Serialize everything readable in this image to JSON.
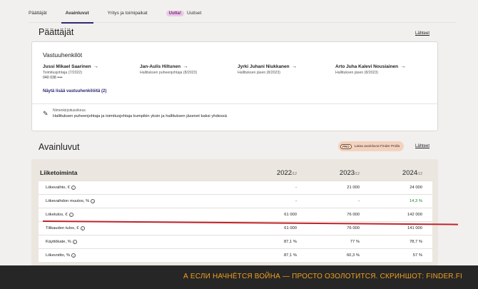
{
  "nav": {
    "tabs": [
      "Päättäjät",
      "Avainluvut",
      "Yritys ja toimipaikat"
    ],
    "new_badge": "Uutta!",
    "news": "Uutiset"
  },
  "officials": {
    "section_title": "Päättäjät",
    "sources_link": "Lähteet",
    "card_title": "Vastuuhenkilöt",
    "people": [
      {
        "name": "Jussi Mikael Saarinen",
        "role": "Toimitusjohtaja (7/2022)",
        "phone": "040 038 ••••"
      },
      {
        "name": "Jan-Aulis Hiltunen",
        "role": "Hallituksen puheenjohtaja (8/2023)"
      },
      {
        "name": "Jyrki Juhani Niukkanen",
        "role": "Hallituksen jäsen (8/2023)"
      },
      {
        "name": "Arto Juha Kalevi Nousiainen",
        "role": "Hallituksen jäsen (8/2023)"
      }
    ],
    "show_more": "Näytä lisää vastuuhenkilöitä (2)",
    "signature_label": "Nimenkirjoitusoikeus",
    "signature_text": "Hallituksen puheenjohtaja ja toimitusjohtaja kumpikin yksin ja hallituksen jäsenet kaksi yhdessä"
  },
  "key_figures": {
    "section_title": "Avainluvut",
    "pro_badge": "PRO",
    "pro_text": "Lataa avainluvut Finder Prolla",
    "sources_link": "Lähteet",
    "table_label": "Liiketoiminta",
    "years": [
      {
        "year": "2022",
        "sub": "/12"
      },
      {
        "year": "2023",
        "sub": "/12"
      },
      {
        "year": "2024",
        "sub": "/12"
      }
    ],
    "rows": [
      {
        "label": "Liikevaihto, €",
        "values": [
          "-",
          "21 000",
          "24 000"
        ]
      },
      {
        "label": "Liikevaihdon muutos, %",
        "values": [
          "-",
          "-",
          "14,3 %"
        ]
      },
      {
        "label": "Liiketulos, €",
        "values": [
          "61 000",
          "76 000",
          "142 000"
        ]
      },
      {
        "label": "Tilikauden tulos, €",
        "values": [
          "61 000",
          "76 000",
          "141 000"
        ]
      },
      {
        "label": "Käyttökate, %",
        "values": [
          "87,1 %",
          "77 %",
          "78,7 %"
        ]
      },
      {
        "label": "Liikevoitto, %",
        "values": [
          "87,1 %",
          "60,3 %",
          "57 %"
        ]
      }
    ],
    "info_glyph": "i"
  },
  "caption": "А ЕСЛИ НАЧНЁТСЯ ВОЙНА — ПРОСТО ОЗОЛОТИТСЯ. СКРИНШОТ: FINDER.FI",
  "colors": {
    "accent": "#2b2b73",
    "green": "#1b7a3a",
    "highlight_line": "#c0232b",
    "caption": "#f0a020"
  }
}
